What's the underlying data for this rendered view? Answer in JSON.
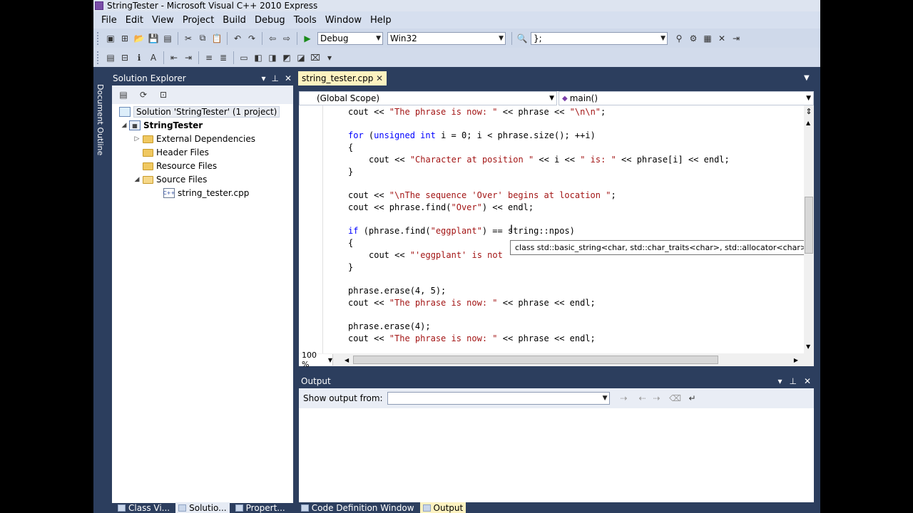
{
  "window": {
    "title": "StringTester - Microsoft Visual C++ 2010 Express"
  },
  "menu": [
    "File",
    "Edit",
    "View",
    "Project",
    "Build",
    "Debug",
    "Tools",
    "Window",
    "Help"
  ],
  "toolbar": {
    "config": "Debug",
    "platform": "Win32",
    "find_value": "};"
  },
  "solution_explorer": {
    "title": "Solution Explorer",
    "side_label": "Document Outline",
    "solution": "Solution 'StringTester' (1 project)",
    "project": "StringTester",
    "items": [
      "External Dependencies",
      "Header Files",
      "Resource Files",
      "Source Files"
    ],
    "file": "string_tester.cpp"
  },
  "editor": {
    "tab": "string_tester.cpp",
    "scope": "(Global Scope)",
    "function": "main()",
    "zoom": "100 %",
    "lines": [
      "cout << \"The phrase is now: \" << phrase << \"\\n\\n\";",
      "for (unsigned int i = 0; i < phrase.size(); ++i)",
      "{",
      "cout << \"Character at position \" << i << \" is: \" << phrase[i] << endl;",
      "}",
      "cout << \"\\nThe sequence 'Over' begins at location \";",
      "cout << phrase.find(\"Over\") << endl;",
      "if (phrase.find(\"eggplant\") == string::npos)",
      "{",
      "cout << \"'eggplant' is not",
      "}",
      "phrase.erase(4, 5);",
      "cout << \"The phrase is now: \" << phrase << endl;",
      "phrase.erase(4);",
      "cout << \"The phrase is now: \" << phrase << endl;"
    ],
    "tooltip": "class std::basic_string<char, std::char_traits<char>, std::allocator<char>>"
  },
  "output": {
    "title": "Output",
    "show_from_label": "Show output from:"
  },
  "bottom_tabs": [
    "Class Vi...",
    "Solutio...",
    "Propert...",
    "Code Definition Window",
    "Output"
  ]
}
